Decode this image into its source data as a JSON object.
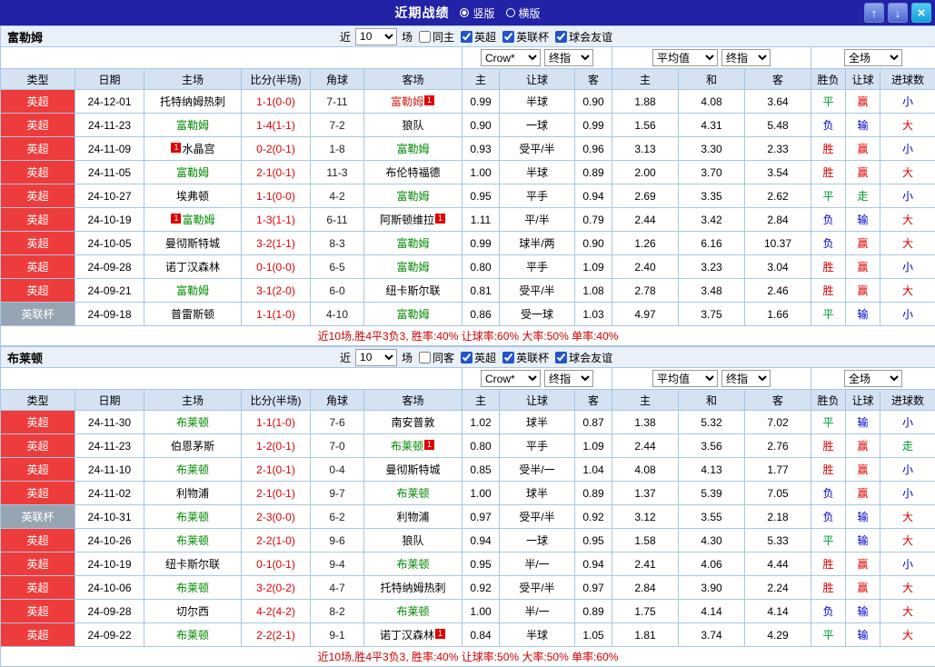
{
  "topbar": {
    "title": "近期战绩",
    "view_vertical": "竖版",
    "view_horizontal": "横版",
    "up_icon": "↑",
    "down_icon": "↓",
    "close_icon": "×"
  },
  "colors": {
    "topbar_bg": "#2122a6",
    "epl_red": "#ee3b3b",
    "cup_gray": "#97a5b3",
    "subject_green": "#008800",
    "win_red": "#e00000",
    "draw_green": "#009933",
    "lose_blue": "#0000cc",
    "header_bg": "#d4e2f2"
  },
  "table_header": {
    "columns": [
      "类型",
      "日期",
      "主场",
      "比分(半场)",
      "角球",
      "客场",
      "主",
      "让球",
      "客",
      "主",
      "和",
      "客",
      "胜负",
      "让球",
      "进球数"
    ],
    "filter": {
      "near": "近",
      "count": "10",
      "matches": "场"
    },
    "leagues": [
      "英超",
      "英联杯",
      "球会友谊"
    ],
    "selects": {
      "bookmaker": "Crow*",
      "final1": "终指",
      "average": "平均值",
      "final2": "终指",
      "scope": "全场"
    }
  },
  "sections": [
    {
      "team": "富勒姆",
      "same_label": "同主",
      "same_checked": false,
      "summary": "近10场,胜4平3负3, 胜率:40% 让球率:60% 大率:50% 单率:40%",
      "rows": [
        {
          "league": "英超",
          "lcls": "epl",
          "date": "24-12-01",
          "home": {
            "name": "托特纳姆热刺",
            "cls": "opp"
          },
          "score": "1-1(0-0)",
          "corner": "7-11",
          "away": {
            "name": "富勒姆",
            "cls": "red",
            "badge_after": "1"
          },
          "o1": "0.99",
          "line": "半球",
          "o2": "0.90",
          "a1": "1.88",
          "a2": "4.08",
          "a3": "3.64",
          "r1": {
            "t": "平",
            "c": "g"
          },
          "r2": {
            "t": "赢",
            "c": "r"
          },
          "r3": {
            "t": "小",
            "c": "b"
          }
        },
        {
          "league": "英超",
          "lcls": "epl",
          "date": "24-11-23",
          "home": {
            "name": "富勒姆",
            "cls": "subj"
          },
          "score": "1-4(1-1)",
          "corner": "7-2",
          "away": {
            "name": "狼队",
            "cls": "opp"
          },
          "o1": "0.90",
          "line": "一球",
          "o2": "0.99",
          "a1": "1.56",
          "a2": "4.31",
          "a3": "5.48",
          "r1": {
            "t": "负",
            "c": "b"
          },
          "r2": {
            "t": "输",
            "c": "b"
          },
          "r3": {
            "t": "大",
            "c": "r"
          }
        },
        {
          "league": "英超",
          "lcls": "epl",
          "date": "24-11-09",
          "home": {
            "name": "水晶宫",
            "cls": "opp",
            "badge_before": "1"
          },
          "score": "0-2(0-1)",
          "corner": "1-8",
          "away": {
            "name": "富勒姆",
            "cls": "subj"
          },
          "o1": "0.93",
          "line": "受平/半",
          "o2": "0.96",
          "a1": "3.13",
          "a2": "3.30",
          "a3": "2.33",
          "r1": {
            "t": "胜",
            "c": "r"
          },
          "r2": {
            "t": "赢",
            "c": "r"
          },
          "r3": {
            "t": "小",
            "c": "b"
          }
        },
        {
          "league": "英超",
          "lcls": "epl",
          "date": "24-11-05",
          "home": {
            "name": "富勒姆",
            "cls": "subj"
          },
          "score": "2-1(0-1)",
          "corner": "11-3",
          "away": {
            "name": "布伦特福德",
            "cls": "opp"
          },
          "o1": "1.00",
          "line": "半球",
          "o2": "0.89",
          "a1": "2.00",
          "a2": "3.70",
          "a3": "3.54",
          "r1": {
            "t": "胜",
            "c": "r"
          },
          "r2": {
            "t": "赢",
            "c": "r"
          },
          "r3": {
            "t": "大",
            "c": "r"
          }
        },
        {
          "league": "英超",
          "lcls": "epl",
          "date": "24-10-27",
          "home": {
            "name": "埃弗顿",
            "cls": "opp"
          },
          "score": "1-1(0-0)",
          "corner": "4-2",
          "away": {
            "name": "富勒姆",
            "cls": "subj"
          },
          "o1": "0.95",
          "line": "平手",
          "o2": "0.94",
          "a1": "2.69",
          "a2": "3.35",
          "a3": "2.62",
          "r1": {
            "t": "平",
            "c": "g"
          },
          "r2": {
            "t": "走",
            "c": "g"
          },
          "r3": {
            "t": "小",
            "c": "b"
          }
        },
        {
          "league": "英超",
          "lcls": "epl",
          "date": "24-10-19",
          "home": {
            "name": "富勒姆",
            "cls": "subj",
            "badge_before": "1"
          },
          "score": "1-3(1-1)",
          "corner": "6-11",
          "away": {
            "name": "阿斯顿维拉",
            "cls": "opp",
            "badge_after": "1"
          },
          "o1": "1.11",
          "line": "平/半",
          "o2": "0.79",
          "a1": "2.44",
          "a2": "3.42",
          "a3": "2.84",
          "r1": {
            "t": "负",
            "c": "b"
          },
          "r2": {
            "t": "输",
            "c": "b"
          },
          "r3": {
            "t": "大",
            "c": "r"
          }
        },
        {
          "league": "英超",
          "lcls": "epl",
          "date": "24-10-05",
          "home": {
            "name": "曼彻斯特城",
            "cls": "opp"
          },
          "score": "3-2(1-1)",
          "corner": "8-3",
          "away": {
            "name": "富勒姆",
            "cls": "subj"
          },
          "o1": "0.99",
          "line": "球半/两",
          "o2": "0.90",
          "a1": "1.26",
          "a2": "6.16",
          "a3": "10.37",
          "r1": {
            "t": "负",
            "c": "b"
          },
          "r2": {
            "t": "赢",
            "c": "r"
          },
          "r3": {
            "t": "大",
            "c": "r"
          }
        },
        {
          "league": "英超",
          "lcls": "epl",
          "date": "24-09-28",
          "home": {
            "name": "诺丁汉森林",
            "cls": "opp"
          },
          "score": "0-1(0-0)",
          "corner": "6-5",
          "away": {
            "name": "富勒姆",
            "cls": "subj"
          },
          "o1": "0.80",
          "line": "平手",
          "o2": "1.09",
          "a1": "2.40",
          "a2": "3.23",
          "a3": "3.04",
          "r1": {
            "t": "胜",
            "c": "r"
          },
          "r2": {
            "t": "赢",
            "c": "r"
          },
          "r3": {
            "t": "小",
            "c": "b"
          }
        },
        {
          "league": "英超",
          "lcls": "epl",
          "date": "24-09-21",
          "home": {
            "name": "富勒姆",
            "cls": "subj"
          },
          "score": "3-1(2-0)",
          "corner": "6-0",
          "away": {
            "name": "纽卡斯尔联",
            "cls": "opp"
          },
          "o1": "0.81",
          "line": "受平/半",
          "o2": "1.08",
          "a1": "2.78",
          "a2": "3.48",
          "a3": "2.46",
          "r1": {
            "t": "胜",
            "c": "r"
          },
          "r2": {
            "t": "赢",
            "c": "r"
          },
          "r3": {
            "t": "大",
            "c": "r"
          }
        },
        {
          "league": "英联杯",
          "lcls": "cup",
          "date": "24-09-18",
          "home": {
            "name": "普雷斯顿",
            "cls": "opp"
          },
          "score": "1-1(1-0)",
          "corner": "4-10",
          "away": {
            "name": "富勒姆",
            "cls": "subj"
          },
          "o1": "0.86",
          "line": "受一球",
          "o2": "1.03",
          "a1": "4.97",
          "a2": "3.75",
          "a3": "1.66",
          "r1": {
            "t": "平",
            "c": "g"
          },
          "r2": {
            "t": "输",
            "c": "b"
          },
          "r3": {
            "t": "小",
            "c": "b"
          }
        }
      ]
    },
    {
      "team": "布莱顿",
      "same_label": "同客",
      "same_checked": false,
      "summary": "近10场,胜4平3负3, 胜率:40% 让球率:50% 大率:50% 单率:60%",
      "rows": [
        {
          "league": "英超",
          "lcls": "epl",
          "date": "24-11-30",
          "home": {
            "name": "布莱顿",
            "cls": "subj"
          },
          "score": "1-1(1-0)",
          "corner": "7-6",
          "away": {
            "name": "南安普敦",
            "cls": "opp"
          },
          "o1": "1.02",
          "line": "球半",
          "o2": "0.87",
          "a1": "1.38",
          "a2": "5.32",
          "a3": "7.02",
          "r1": {
            "t": "平",
            "c": "g"
          },
          "r2": {
            "t": "输",
            "c": "b"
          },
          "r3": {
            "t": "小",
            "c": "b"
          }
        },
        {
          "league": "英超",
          "lcls": "epl",
          "date": "24-11-23",
          "home": {
            "name": "伯恩茅斯",
            "cls": "opp"
          },
          "score": "1-2(0-1)",
          "corner": "7-0",
          "away": {
            "name": "布莱顿",
            "cls": "subj",
            "badge_after": "1"
          },
          "o1": "0.80",
          "line": "平手",
          "o2": "1.09",
          "a1": "2.44",
          "a2": "3.56",
          "a3": "2.76",
          "r1": {
            "t": "胜",
            "c": "r"
          },
          "r2": {
            "t": "赢",
            "c": "r"
          },
          "r3": {
            "t": "走",
            "c": "g"
          }
        },
        {
          "league": "英超",
          "lcls": "epl",
          "date": "24-11-10",
          "home": {
            "name": "布莱顿",
            "cls": "subj"
          },
          "score": "2-1(0-1)",
          "corner": "0-4",
          "away": {
            "name": "曼彻斯特城",
            "cls": "opp"
          },
          "o1": "0.85",
          "line": "受半/一",
          "o2": "1.04",
          "a1": "4.08",
          "a2": "4.13",
          "a3": "1.77",
          "r1": {
            "t": "胜",
            "c": "r"
          },
          "r2": {
            "t": "赢",
            "c": "r"
          },
          "r3": {
            "t": "小",
            "c": "b"
          }
        },
        {
          "league": "英超",
          "lcls": "epl",
          "date": "24-11-02",
          "home": {
            "name": "利物浦",
            "cls": "opp"
          },
          "score": "2-1(0-1)",
          "corner": "9-7",
          "away": {
            "name": "布莱顿",
            "cls": "subj"
          },
          "o1": "1.00",
          "line": "球半",
          "o2": "0.89",
          "a1": "1.37",
          "a2": "5.39",
          "a3": "7.05",
          "r1": {
            "t": "负",
            "c": "b"
          },
          "r2": {
            "t": "赢",
            "c": "r"
          },
          "r3": {
            "t": "小",
            "c": "b"
          }
        },
        {
          "league": "英联杯",
          "lcls": "cup",
          "date": "24-10-31",
          "home": {
            "name": "布莱顿",
            "cls": "subj"
          },
          "score": "2-3(0-0)",
          "corner": "6-2",
          "away": {
            "name": "利物浦",
            "cls": "opp"
          },
          "o1": "0.97",
          "line": "受平/半",
          "o2": "0.92",
          "a1": "3.12",
          "a2": "3.55",
          "a3": "2.18",
          "r1": {
            "t": "负",
            "c": "b"
          },
          "r2": {
            "t": "输",
            "c": "b"
          },
          "r3": {
            "t": "大",
            "c": "r"
          }
        },
        {
          "league": "英超",
          "lcls": "epl",
          "date": "24-10-26",
          "home": {
            "name": "布莱顿",
            "cls": "subj"
          },
          "score": "2-2(1-0)",
          "corner": "9-6",
          "away": {
            "name": "狼队",
            "cls": "opp"
          },
          "o1": "0.94",
          "line": "一球",
          "o2": "0.95",
          "a1": "1.58",
          "a2": "4.30",
          "a3": "5.33",
          "r1": {
            "t": "平",
            "c": "g"
          },
          "r2": {
            "t": "输",
            "c": "b"
          },
          "r3": {
            "t": "大",
            "c": "r"
          }
        },
        {
          "league": "英超",
          "lcls": "epl",
          "date": "24-10-19",
          "home": {
            "name": "纽卡斯尔联",
            "cls": "opp"
          },
          "score": "0-1(0-1)",
          "corner": "9-4",
          "away": {
            "name": "布莱顿",
            "cls": "subj"
          },
          "o1": "0.95",
          "line": "半/一",
          "o2": "0.94",
          "a1": "2.41",
          "a2": "4.06",
          "a3": "4.44",
          "r1": {
            "t": "胜",
            "c": "r"
          },
          "r2": {
            "t": "赢",
            "c": "r"
          },
          "r3": {
            "t": "小",
            "c": "b"
          }
        },
        {
          "league": "英超",
          "lcls": "epl",
          "date": "24-10-06",
          "home": {
            "name": "布莱顿",
            "cls": "subj"
          },
          "score": "3-2(0-2)",
          "corner": "4-7",
          "away": {
            "name": "托特纳姆热刺",
            "cls": "opp"
          },
          "o1": "0.92",
          "line": "受平/半",
          "o2": "0.97",
          "a1": "2.84",
          "a2": "3.90",
          "a3": "2.24",
          "r1": {
            "t": "胜",
            "c": "r"
          },
          "r2": {
            "t": "赢",
            "c": "r"
          },
          "r3": {
            "t": "大",
            "c": "r"
          }
        },
        {
          "league": "英超",
          "lcls": "epl",
          "date": "24-09-28",
          "home": {
            "name": "切尔西",
            "cls": "opp"
          },
          "score": "4-2(4-2)",
          "corner": "8-2",
          "away": {
            "name": "布莱顿",
            "cls": "subj"
          },
          "o1": "1.00",
          "line": "半/一",
          "o2": "0.89",
          "a1": "1.75",
          "a2": "4.14",
          "a3": "4.14",
          "r1": {
            "t": "负",
            "c": "b"
          },
          "r2": {
            "t": "输",
            "c": "b"
          },
          "r3": {
            "t": "大",
            "c": "r"
          }
        },
        {
          "league": "英超",
          "lcls": "epl",
          "date": "24-09-22",
          "home": {
            "name": "布莱顿",
            "cls": "subj"
          },
          "score": "2-2(2-1)",
          "corner": "9-1",
          "away": {
            "name": "诺丁汉森林",
            "cls": "opp",
            "badge_after": "1"
          },
          "o1": "0.84",
          "line": "半球",
          "o2": "1.05",
          "a1": "1.81",
          "a2": "3.74",
          "a3": "4.29",
          "r1": {
            "t": "平",
            "c": "g"
          },
          "r2": {
            "t": "输",
            "c": "b"
          },
          "r3": {
            "t": "大",
            "c": "r"
          }
        }
      ]
    }
  ]
}
